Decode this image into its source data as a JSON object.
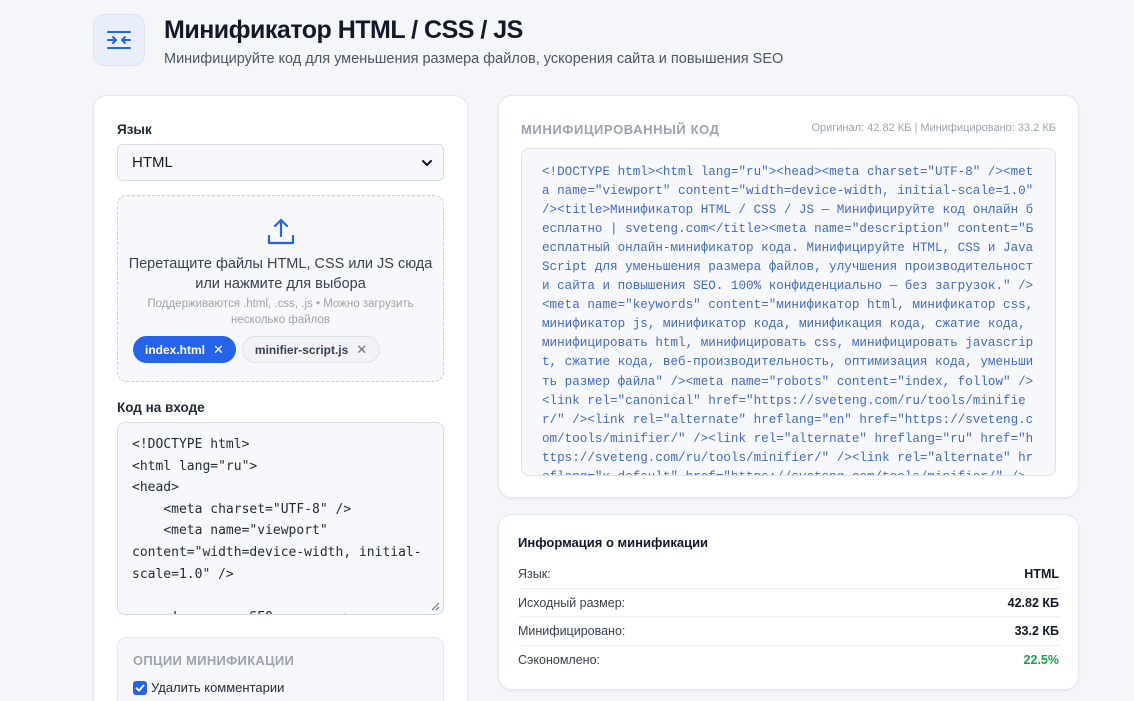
{
  "header": {
    "title": "Минификатор HTML / CSS / JS",
    "subtitle": "Минифицируйте код для уменьшения размера файлов, ускорения сайта и повышения SEO",
    "logo_icon": "compress-arrows-icon"
  },
  "left": {
    "language_label": "Язык",
    "language_value": "HTML",
    "dropzone": {
      "main_text": "Перетащите файлы HTML, CSS или JS сюда или нажмите для выбора",
      "hint": "Поддерживаются .html, .css, .js • Можно загрузить несколько файлов",
      "icon": "upload-icon"
    },
    "files": [
      {
        "name": "index.html",
        "active": true
      },
      {
        "name": "minifier-script.js",
        "active": false
      }
    ],
    "input_label": "Код на входе",
    "input_code": "<!DOCTYPE html>\n<html lang=\"ru\">\n<head>\n    <meta charset=\"UTF-8\" />\n    <meta name=\"viewport\" content=\"width=device-width, initial-scale=1.0\" />\n\n    <!-- ===== SEO ===== -->",
    "options_title": "ОПЦИИ МИНИФИКАЦИИ",
    "options": [
      {
        "label": "Удалить комментарии",
        "checked": true
      }
    ]
  },
  "output": {
    "title": "МИНИФИЦИРОВАННЫЙ КОД",
    "stats": "Оригинал: 42.82 КБ | Минифицировано: 33.2 КБ",
    "code": "<!DOCTYPE html><html lang=\"ru\"><head><meta charset=\"UTF-8\" /><meta name=\"viewport\" content=\"width=device-width, initial-scale=1.0\" /><title>Минификатор HTML / CSS / JS — Минифицируйте код онлайн бесплатно | sveteng.com</title><meta name=\"description\" content=\"Бесплатный онлайн-минификатор кода. Минифицируйте HTML, CSS и JavaScript для уменьшения размера файлов, улучшения производительности сайта и повышения SEO. 100% конфиденциально — без загрузок.\" /><meta name=\"keywords\" content=\"минификатор html, минификатор css, минификатор js, минификатор кода, минификация кода, сжатие кода, минифицировать html, минифицировать css, минифицировать javascript, сжатие кода, веб-производительность, оптимизация кода, уменьшить размер файла\" /><meta name=\"robots\" content=\"index, follow\" /><link rel=\"canonical\" href=\"https://sveteng.com/ru/tools/minifier/\" /><link rel=\"alternate\" hreflang=\"en\" href=\"https://sveteng.com/tools/minifier/\" /><link rel=\"alternate\" hreflang=\"ru\" href=\"https://sveteng.com/ru/tools/minifier/\" /><link rel=\"alternate\" hreflang=\"x-default\" href=\"https://sveteng.com/tools/minifier/\" />"
  },
  "info": {
    "title": "Информация о минификации",
    "rows": [
      {
        "key": "Язык:",
        "value": "HTML"
      },
      {
        "key": "Исходный размер:",
        "value": "42.82 КБ"
      },
      {
        "key": "Минифицировано:",
        "value": "33.2 КБ"
      },
      {
        "key": "Сэкономлено:",
        "value": "22.5%"
      }
    ]
  },
  "colors": {
    "accent": "#2563eb",
    "success": "#16a34a",
    "code_text": "#4169c9"
  }
}
